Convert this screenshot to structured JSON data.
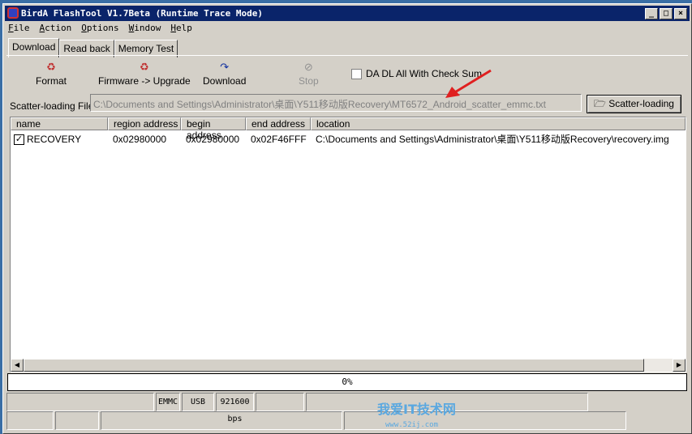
{
  "window": {
    "title": "BirdA FlashTool V1.7Beta (Runtime Trace Mode)",
    "minimize": "_",
    "maximize": "□",
    "close": "×"
  },
  "menu": [
    "File",
    "Action",
    "Options",
    "Window",
    "Help"
  ],
  "tabs": [
    "Download",
    "Read back",
    "Memory Test"
  ],
  "toolbar": {
    "format": "Format",
    "firmware": "Firmware -> Upgrade",
    "download": "Download",
    "stop": "Stop",
    "checksum_label": "DA DL All With Check Sum"
  },
  "scatter": {
    "label": "Scatter-loading File",
    "value": "C:\\Documents and Settings\\Administrator\\桌面\\Y511移动版Recovery\\MT6572_Android_scatter_emmc.txt",
    "button": "Scatter-loading"
  },
  "table": {
    "columns": [
      "name",
      "region address",
      "begin address",
      "end address",
      "location"
    ],
    "rows": [
      {
        "name": "RECOVERY",
        "region": "0x02980000",
        "begin": "0x02980000",
        "end": "0x02F46FFF",
        "location": "C:\\Documents and Settings\\Administrator\\桌面\\Y511移动版Recovery\\recovery.img",
        "checked": true
      }
    ]
  },
  "progress": {
    "text": "0%",
    "value": 0
  },
  "status": {
    "storage": "EMMC",
    "port": "USB",
    "baud": "921600 bps"
  },
  "watermark": {
    "text": "我爱IT技术网",
    "url": "www.52ij.com"
  },
  "colors": {
    "titlebar": "#0a246a",
    "face": "#d4d0c8",
    "arrow": "#e02020"
  }
}
